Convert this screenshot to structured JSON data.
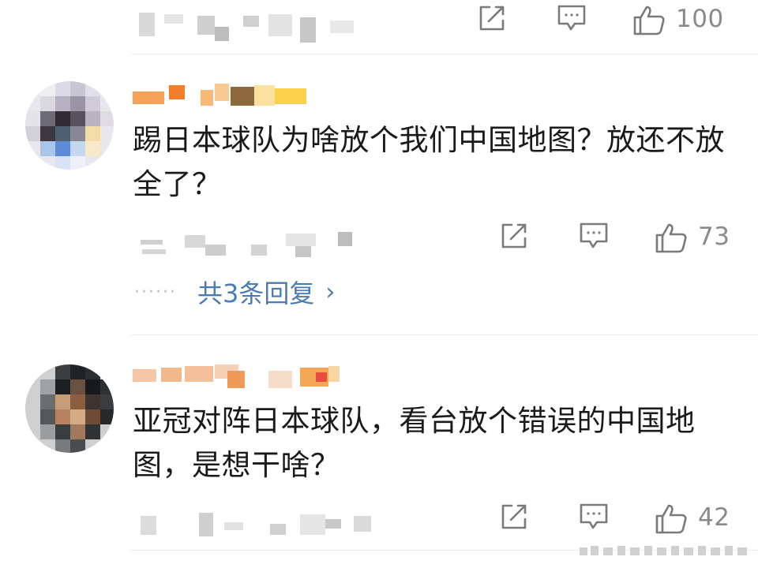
{
  "comments": [
    {
      "id": "c0",
      "partial": true,
      "like_count": "100"
    },
    {
      "id": "c1",
      "text": "踢日本球队为啥放个我们中国地图？放还不放全了？",
      "like_count": "73",
      "replies_label": "共3条回复"
    },
    {
      "id": "c2",
      "text": "亚冠对阵日本球队，看台放个错误的中国地图，是想干啥？",
      "like_count": "42"
    }
  ],
  "reply_dots": "······",
  "reply_chevron": "›",
  "icons": {
    "share": "share-icon",
    "comment": "comment-icon",
    "like": "thumbs-up-icon",
    "watermark": "weibo-watermark-icon"
  },
  "colors": {
    "text": "#1a1a1a",
    "meta": "#8a8a8a",
    "link": "#4a7bb3",
    "divider": "#ececec"
  }
}
